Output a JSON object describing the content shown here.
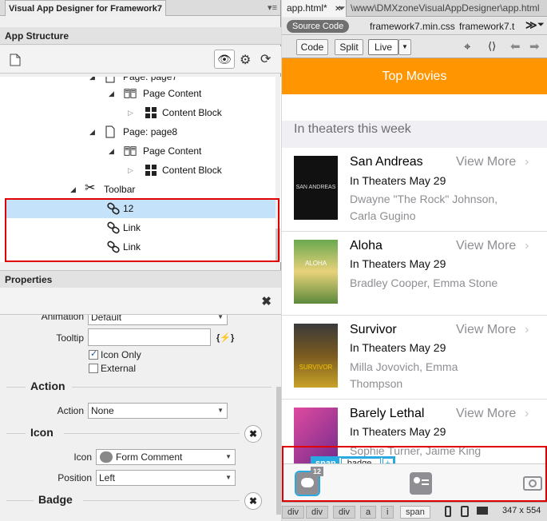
{
  "left_panel": {
    "title": "Visual App Designer for Framework7",
    "menu_icon": "menu-icon",
    "app_structure": "App Structure",
    "tree": [
      {
        "label": "Page: page7",
        "icon": "page-icon",
        "type": "page"
      },
      {
        "label": "Page Content",
        "icon": "book-icon",
        "type": "content"
      },
      {
        "label": "Content Block",
        "icon": "grid-icon",
        "type": "block"
      },
      {
        "label": "Page: page8",
        "icon": "page-icon",
        "type": "page"
      },
      {
        "label": "Page Content",
        "icon": "book-icon",
        "type": "content"
      },
      {
        "label": "Content Block",
        "icon": "grid-icon",
        "type": "block"
      },
      {
        "label": "Toolbar",
        "icon": "tools-icon",
        "type": "toolbar"
      },
      {
        "label": "12",
        "icon": "link-icon",
        "type": "link"
      },
      {
        "label": "Link",
        "icon": "link-icon",
        "type": "link"
      },
      {
        "label": "Link",
        "icon": "link-icon",
        "type": "link"
      }
    ],
    "properties": "Properties",
    "props": {
      "animation_label": "Animation",
      "animation_value": "Default",
      "tooltip_label": "Tooltip",
      "tooltip_value": "",
      "dyn_btn": "{⚡}",
      "icon_only": "Icon Only",
      "icon_only_checked": true,
      "external": "External",
      "external_checked": false,
      "action_group": "Action",
      "action_label": "Action",
      "action_value": "None",
      "icon_group": "Icon",
      "icon_label": "Icon",
      "icon_value": "Form Comment",
      "position_label": "Position",
      "position_value": "Left",
      "badge_group": "Badge"
    }
  },
  "right_panel": {
    "doc_tab": "app.html*",
    "path": "\\www\\DMXzoneVisualAppDesigner\\app.html",
    "source_code": "Source Code",
    "files": [
      "framework7.min.css",
      "framework7.t"
    ],
    "view_buttons": [
      "Code",
      "Split",
      "Live"
    ],
    "phone": {
      "nav_title": "Top Movies",
      "section_title": "In theaters this week",
      "view_more": "View More",
      "movies": [
        {
          "title": "San Andreas",
          "date": "In Theaters May 29",
          "cast": "Dwayne \"The Rock\" Johnson, Carla Gugino",
          "poster_color": "#111111",
          "poster_text": "SAN ANDREAS"
        },
        {
          "title": "Aloha",
          "date": "In Theaters May 29",
          "cast": "Bradley Cooper, Emma Stone",
          "poster_color": "#5c8a3a",
          "poster_text": "ALOHA"
        },
        {
          "title": "Survivor",
          "date": "In Theaters May 29",
          "cast": "Milla Jovovich, Emma Thompson",
          "poster_color": "#7a5a20",
          "poster_text": "SURVIVOR"
        },
        {
          "title": "Barely Lethal",
          "date": "In Theaters May 29",
          "cast": "Sophie Turner, Jaime King",
          "poster_color": "#a03a8a",
          "poster_text": ""
        }
      ],
      "element_tag": "span",
      "element_class": ".badge",
      "plus": "+",
      "badge_count": "12"
    },
    "status": {
      "crumbs": [
        "div",
        "div",
        "div",
        "a",
        "i",
        "span"
      ],
      "size": "347 x 554"
    }
  },
  "colors": {
    "accent": "#ff9500",
    "selection": "#c4e3fa",
    "highlight": "#e00000",
    "tag_blue": "#29a9e1"
  }
}
